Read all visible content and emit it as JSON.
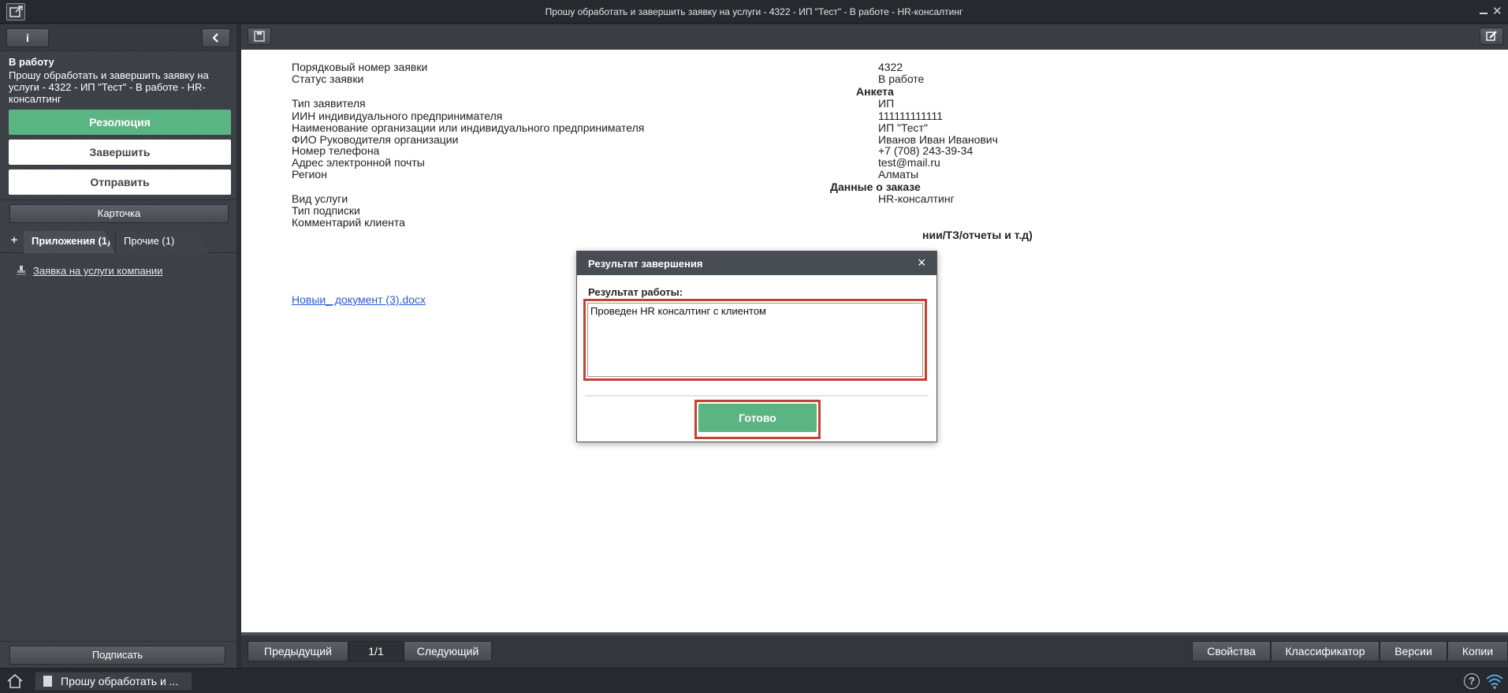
{
  "window": {
    "title": "Прошу обработать и завершить заявку на услуги - 4322 - ИП \"Тест\" - В работе - HR-консалтинг"
  },
  "sidebar": {
    "info_label": "i",
    "status_title": "В работу",
    "status_desc": "Прошу обработать и завершить заявку на услуги - 4322 - ИП \"Тест\" - В работе - HR-консалтинг",
    "btn_resolution": "Резолюция",
    "btn_finish": "Завершить",
    "btn_send": "Отправить",
    "btn_card": "Карточка",
    "tab_attachments": "Приложения (1)",
    "tab_other": "Прочие (1)",
    "attachment": "Заявка на услуги компании",
    "btn_sign": "Подписать"
  },
  "document": {
    "rows": [
      {
        "label": "Порядковый номер заявки",
        "value": "4322"
      },
      {
        "label": "Статус заявки",
        "value": "В работе"
      },
      {
        "label": "Тип заявителя",
        "value": "ИП"
      },
      {
        "label": "ИИН индивидуального предпринимателя",
        "value": "111111111111"
      },
      {
        "label": "Наименование организации или индивидуального предпринимателя",
        "value": "ИП \"Тест\""
      },
      {
        "label": "ФИО Руководителя организации",
        "value": "Иванов Иван Иванович"
      },
      {
        "label": "Номер телефона",
        "value": "+7 (708) 243-39-34"
      },
      {
        "label": "Адрес электронной почты",
        "value": "test@mail.ru"
      },
      {
        "label": "Регион",
        "value": "Алматы"
      },
      {
        "label": "Вид услуги",
        "value": "HR-консалтинг"
      },
      {
        "label": "Тип подписки"
      },
      {
        "label": "Комментарий клиента"
      }
    ],
    "section_anketa": "Анкета",
    "section_order": "Данные о заказе",
    "section_partial": "нии/ТЗ/отчеты и т.д)",
    "file_link": "Новыи_ документ (3).docx"
  },
  "bottom": {
    "prev": "Предыдущий",
    "page": "1/1",
    "next": "Следующий",
    "props": "Свойства",
    "classifier": "Классификатор",
    "versions": "Версии",
    "copies": "Копии"
  },
  "taskbar": {
    "item": "Прошу обработать и ...",
    "help": "?"
  },
  "modal": {
    "title": "Результат завершения",
    "close": "×",
    "label": "Результат работы:",
    "text": "Проведен HR консалтинг с клиентом",
    "done": "Готово"
  }
}
